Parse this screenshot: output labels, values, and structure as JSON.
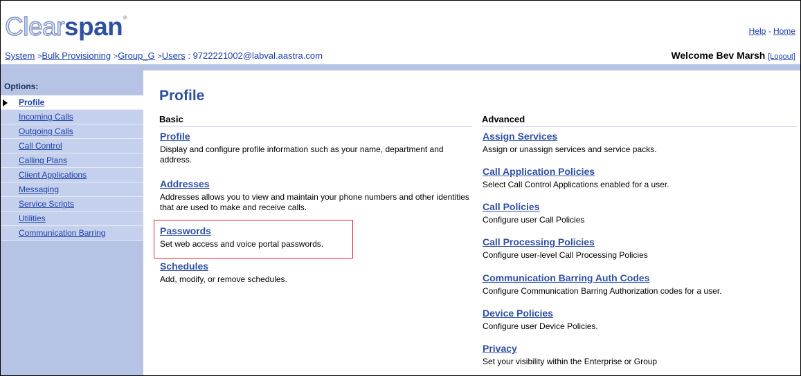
{
  "header": {
    "logo_light": "Clear",
    "logo_bold": "span",
    "logo_tm": "®",
    "help": "Help",
    "separator": " - ",
    "home": "Home"
  },
  "breadcrumb": {
    "items": [
      "System",
      "Bulk Provisioning",
      "Group_G",
      "Users"
    ],
    "separator": ">",
    "current_sep": ":",
    "current": "9722221002@labval.aastra.com"
  },
  "welcome": {
    "text": "Welcome Bev Marsh",
    "logout": "[Logout]"
  },
  "sidebar": {
    "label": "Options:",
    "items": [
      {
        "label": "Profile",
        "selected": true
      },
      {
        "label": "Incoming Calls"
      },
      {
        "label": "Outgoing Calls"
      },
      {
        "label": "Call Control"
      },
      {
        "label": "Calling Plans"
      },
      {
        "label": "Client Applications"
      },
      {
        "label": "Messaging"
      },
      {
        "label": "Service Scripts"
      },
      {
        "label": "Utilities"
      },
      {
        "label": "Communication Barring"
      }
    ]
  },
  "main": {
    "title": "Profile",
    "basic": {
      "heading": "Basic",
      "items": [
        {
          "title": "Profile",
          "desc": "Display and configure profile information such as your name, department and address."
        },
        {
          "title": "Addresses",
          "desc": "Addresses allows you to view and maintain your phone numbers and other identities that are used to make and receive calls."
        },
        {
          "title": "Passwords",
          "desc": "Set web access and voice portal passwords."
        },
        {
          "title": "Schedules",
          "desc": "Add, modify, or remove schedules."
        }
      ]
    },
    "advanced": {
      "heading": "Advanced",
      "items": [
        {
          "title": "Assign Services",
          "desc": "Assign or unassign services and service packs."
        },
        {
          "title": "Call Application Policies",
          "desc": "Select Call Control Applications enabled for a user."
        },
        {
          "title": "Call Policies",
          "desc": "Configure user Call Policies"
        },
        {
          "title": "Call Processing Policies",
          "desc": "Configure user-level Call Processing Policies"
        },
        {
          "title": "Communication Barring Auth Codes",
          "desc": "Configure Communication Barring Authorization codes for a user."
        },
        {
          "title": "Device Policies",
          "desc": "Configure user Device Policies."
        },
        {
          "title": "Privacy",
          "desc": "Set your visibility within the Enterprise or Group"
        }
      ]
    }
  },
  "colors": {
    "brand": "#2e4fa3",
    "link": "#1a3ea8",
    "sidebar": "#b6c3e5",
    "highlight": "#e0212a"
  }
}
